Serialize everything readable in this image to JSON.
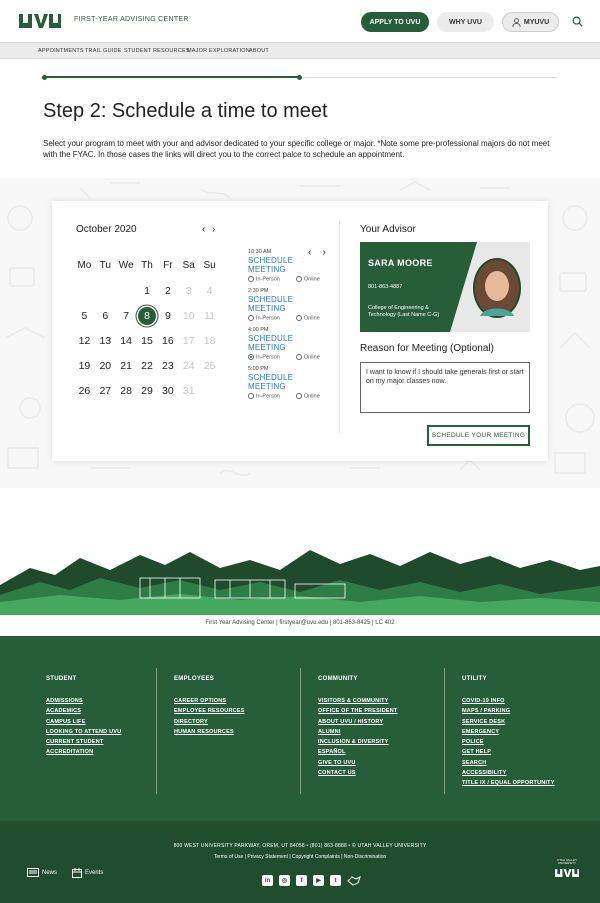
{
  "header": {
    "logo_text": "UVU",
    "site_title": "FIRST-YEAR ADVISING CENTER",
    "apply_label": "APPLY TO UVU",
    "why_label": "WHY UVU",
    "my_label": "MYUVU"
  },
  "nav": {
    "items": [
      "APPOINTMENTS",
      "TRAIL GUIDE",
      "STUDENT RESOURCES",
      "MAJOR EXPLORATION",
      "ABOUT"
    ]
  },
  "progress": {
    "fraction": 0.5
  },
  "step": {
    "title": "Step 2: Schedule a time to meet",
    "description": "Select your program to meet with your and advisor dedicated to your specific college or major. *Note some pre-professional majors do not meet with the FYAC. In those cases the links will direct you to the correct palce to schedule an appointment."
  },
  "calendar": {
    "month": "October 2020",
    "prev": "‹",
    "next": "›",
    "weekdays": [
      "Mo",
      "Tu",
      "We",
      "Th",
      "Fr",
      "Sa",
      "Su"
    ],
    "weeks": [
      [
        "",
        "",
        "",
        "1",
        "2",
        "3",
        "4"
      ],
      [
        "5",
        "6",
        "7",
        "8",
        "9",
        "10",
        "11"
      ],
      [
        "12",
        "13",
        "14",
        "15",
        "16",
        "17",
        "18"
      ],
      [
        "19",
        "20",
        "21",
        "22",
        "23",
        "24",
        "25"
      ],
      [
        "26",
        "27",
        "28",
        "29",
        "30",
        "31",
        ""
      ]
    ],
    "selected": "8",
    "dimmed": [
      "3",
      "4",
      "10",
      "11",
      "17",
      "18",
      "24",
      "25",
      "31"
    ]
  },
  "slots": {
    "prev": "‹",
    "next": "›",
    "items": [
      {
        "time": "10:30 AM",
        "title": "SCHEDULE MEETING",
        "opt1": "In-Person",
        "opt2": "Online",
        "selected": ""
      },
      {
        "time": "2:30 PM",
        "title": "SCHEDULE MEETING",
        "opt1": "In-Person",
        "opt2": "Online",
        "selected": ""
      },
      {
        "time": "4:00 PM",
        "title": "SCHEDULE MEETING",
        "opt1": "In-Person",
        "opt2": "Online",
        "selected": "In-Person"
      },
      {
        "time": "5:00 PM",
        "title": "SCHEDULE MEETING",
        "opt1": "In-Person",
        "opt2": "Online",
        "selected": ""
      }
    ]
  },
  "advisor": {
    "heading": "Your Advisor",
    "name": "SARA MOORE",
    "phone": "801-863-4887",
    "dept": "College of Engineering & Technology (Last Name C-G)"
  },
  "reason": {
    "heading": "Reason for Meeting (Optional)",
    "text": "I want to know if I should take generals first or start on my major classes now."
  },
  "schedule_button": "SCHEDULE YOUR MEETING",
  "contact_line": "First Year Advising Center  |  firstyear@uvu.edu  |  801-863-8425  |  LC 402",
  "footer": {
    "student": {
      "heading": "STUDENT",
      "links": [
        "ADMISSIONS",
        "ACADEMICS",
        "CAMPUS LIFE",
        "LOOKING TO ATTEND UVU",
        "CURRENT STUDENT",
        "ACCREDITATION"
      ]
    },
    "employees": {
      "heading": "EMPLOYEES",
      "links": [
        "CAREER OPTIONS",
        "EMPLOYEE RESOURCES",
        "DIRECTORY",
        "HUMAN RESOURCES"
      ]
    },
    "community": {
      "heading": "COMMUNITY",
      "links": [
        "VISITORS & COMMUNITY",
        "OFFICE OF THE PRESIDENT",
        "ABOUT UVU / HISTORY",
        "ALUMNI",
        "INCLUSION & DIVERSITY",
        "ESPAÑOL",
        "GIVE TO UVU",
        "CONTACT US"
      ]
    },
    "utility": {
      "heading": "UTILITY",
      "links": [
        "COVID-19 INFO",
        "MAPS / PARKING",
        "SERVICE DESK",
        "EMERGENCY",
        "POLICE",
        "GET HELP",
        "SEARCH",
        "ACCESSIBILITY",
        "TITLE IX / EQUAL OPPORTUNITY"
      ]
    },
    "address": "800 WEST UNIVERSITY PARKWAY, OREM, UT 84058 • (801) 863-8888 • © UTAH VALLEY UNIVERSITY",
    "terms": "Terms of Use  |  Privacy Statement  |  Copyright Complaints  |  Non-Discrimination",
    "news": "News",
    "events": "Events",
    "uvu_badge": "UTAH VALLEY UNIVERSITY"
  },
  "colors": {
    "brand_green": "#275d38",
    "link_blue": "#2b7bbf"
  }
}
